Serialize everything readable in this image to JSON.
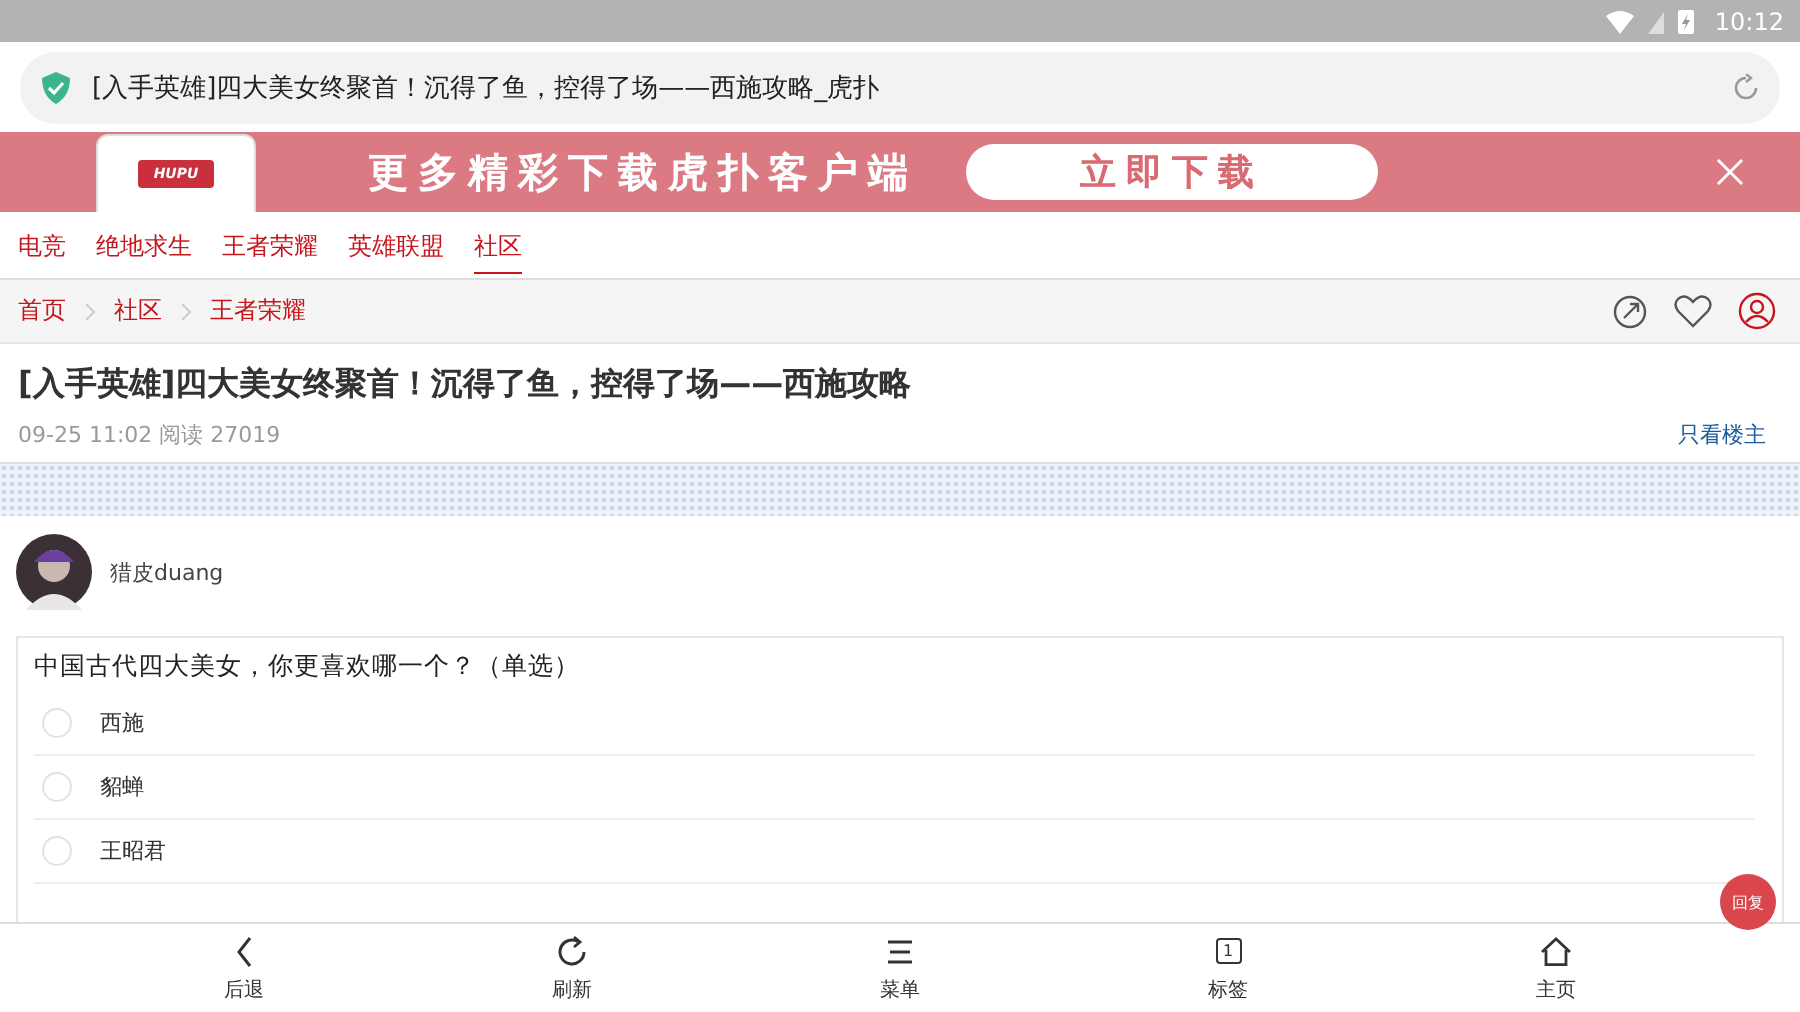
{
  "status_bar": {
    "time": "10:12"
  },
  "address_bar": {
    "title": "[入手英雄]四大美女终聚首！沉得了鱼，控得了场——西施攻略_虎扑"
  },
  "banner": {
    "text": "更多精彩下载虎扑客户端",
    "button": "立即下载",
    "logo": "HUPU"
  },
  "tabs": [
    {
      "label": "电竞",
      "selected": false
    },
    {
      "label": "绝地求生",
      "selected": false
    },
    {
      "label": "王者荣耀",
      "selected": false
    },
    {
      "label": "英雄联盟",
      "selected": false
    },
    {
      "label": "社区",
      "selected": true
    }
  ],
  "breadcrumb": [
    "首页",
    "社区",
    "王者荣耀"
  ],
  "post": {
    "title": "[入手英雄]四大美女终聚首！沉得了鱼，控得了场——西施攻略",
    "meta": "09-25 11:02  阅读 27019",
    "filter_link": "只看楼主",
    "author": "猎皮duang"
  },
  "poll": {
    "question": "中国古代四大美女，你更喜欢哪一个？（单选）",
    "options": [
      {
        "label": "西施",
        "selected": false
      },
      {
        "label": "貂蝉",
        "selected": false
      },
      {
        "label": "王昭君",
        "selected": false
      }
    ]
  },
  "reply_button": "回复",
  "bottom_nav": [
    {
      "label": "后退",
      "kind": "back"
    },
    {
      "label": "刷新",
      "kind": "refresh"
    },
    {
      "label": "菜单",
      "kind": "menu"
    },
    {
      "label": "标签",
      "kind": "tabs",
      "badge": "1"
    },
    {
      "label": "主页",
      "kind": "home"
    }
  ]
}
